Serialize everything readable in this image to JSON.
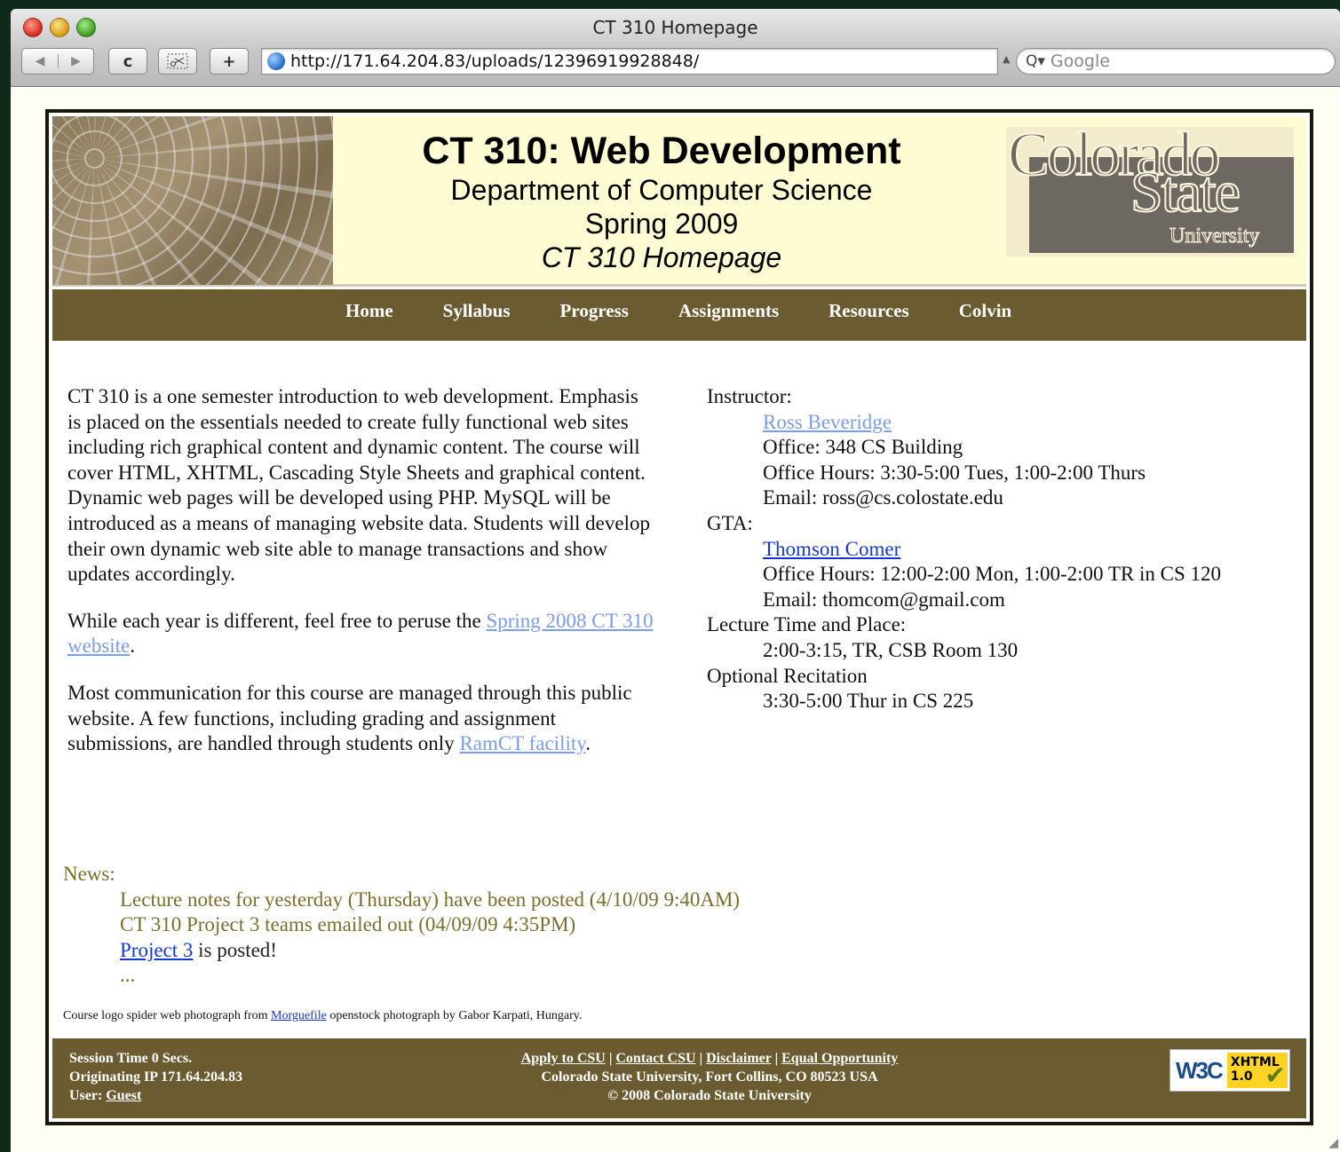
{
  "browser": {
    "window_title": "CT 310 Homepage",
    "url": "http://171.64.204.83/uploads/12396919928848/",
    "search_placeholder": "Google",
    "buttons": {
      "back": "◀",
      "forward": "▶",
      "reload": "c",
      "add": "+"
    }
  },
  "header": {
    "title": "CT 310: Web Development",
    "department": "Department of Computer Science",
    "term": "Spring 2009",
    "page_name": "CT 310 Homepage",
    "logo": {
      "line1": "Colorado",
      "line2": "State",
      "line3": "University"
    }
  },
  "nav": {
    "items": [
      "Home",
      "Syllabus",
      "Progress",
      "Assignments",
      "Resources",
      "Colvin"
    ]
  },
  "intro": {
    "p1": "CT 310 is a one semester introduction to web development. Emphasis is placed on the essentials needed to create fully functional web sites including rich graphical content and dynamic content. The course will cover HTML, XHTML, Cascading Style Sheets and graphical content. Dynamic web pages will be developed using PHP. MySQL will be introduced as a means of managing website data. Students will develop their own dynamic web site able to manage transactions and show updates accordingly.",
    "p2_before": "While each year is different, feel free to peruse the ",
    "p2_link": "Spring 2008 CT 310 website",
    "p2_after": ".",
    "p3_before": "Most communication for this course are managed through this public website. A few functions, including grading and assignment submissions, are handled through students only ",
    "p3_link": "RamCT facility",
    "p3_after": "."
  },
  "staff": {
    "instructor_label": "Instructor:",
    "instructor_name": "Ross Beveridge",
    "instructor_office": "Office: 348 CS Building",
    "instructor_hours": "Office Hours: 3:30-5:00 Tues, 1:00-2:00 Thurs",
    "instructor_email": "Email: ross@cs.colostate.edu",
    "gta_label": "GTA:",
    "gta_name": "Thomson Comer",
    "gta_hours": "Office Hours: 12:00-2:00 Mon, 1:00-2:00 TR in CS 120",
    "gta_email": "Email: thomcom@gmail.com",
    "lecture_label": "Lecture Time and Place:",
    "lecture_value": "2:00-3:15, TR, CSB Room 130",
    "recitation_label": "Optional Recitation",
    "recitation_value": "3:30-5:00 Thur in CS 225"
  },
  "news": {
    "label": "News:",
    "item1": "Lecture notes for yesterday (Thursday) have been posted (4/10/09 9:40AM)",
    "item2": "CT 310 Project 3 teams emailed out (04/09/09 4:35PM)",
    "item3_link": "Project 3",
    "item3_after": " is posted!",
    "more": "..."
  },
  "credit": {
    "before": "Course logo spider web photograph from ",
    "link": "Morguefile",
    "after": " openstock photograph by Gabor Karpati, Hungary."
  },
  "footer": {
    "session": "Session Time 0 Secs.",
    "ip": "Originating IP 171.64.204.83",
    "user_label": "User: ",
    "user_link": "Guest",
    "links": [
      "Apply to CSU",
      "Contact CSU",
      "Disclaimer",
      "Equal Opportunity"
    ],
    "separator": " | ",
    "address": "Colorado State University, Fort Collins, CO 80523 USA",
    "copyright": "© 2008 Colorado State University",
    "badge_w3c": "W3C",
    "badge_xhtml": "XHTML",
    "badge_version": "1.0"
  }
}
